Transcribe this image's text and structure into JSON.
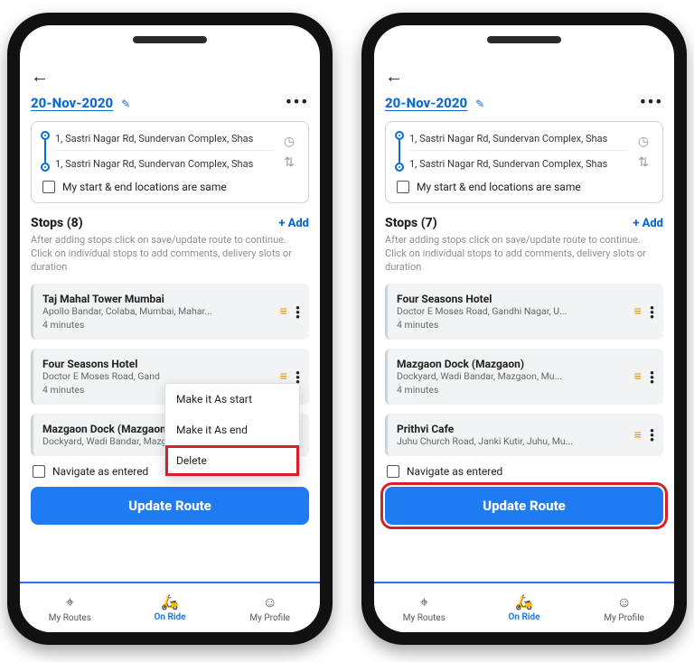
{
  "header": {
    "date": "20-Nov-2020",
    "more": "•••"
  },
  "routeCard": {
    "startAddress": "1, Sastri Nagar Rd, Sundervan Complex, Shas",
    "endAddress": "1, Sastri Nagar Rd, Sundervan Complex, Shas",
    "sameLocCheckbox": "My start & end locations are same"
  },
  "stopsSection": {
    "labelPrefix": "Stops",
    "addLabel": "+ Add",
    "hint": "After adding stops click on save/update route to continue. Click on individual stops to add comments, delivery slots or duration"
  },
  "navCheckbox": "Navigate as entered",
  "cta": "Update Route",
  "nav": {
    "routes": "My Routes",
    "onride": "On Ride",
    "profile": "My Profile"
  },
  "contextMenu": {
    "start": "Make it As start",
    "end": "Make it As end",
    "delete": "Delete"
  },
  "phones": [
    {
      "stopCountLabel": "Stops (8)",
      "menuTop": 396,
      "showMenu": true,
      "highlightCta": false,
      "stops": [
        {
          "name": "Taj Mahal Tower Mumbai",
          "addr": "Apollo Bandar, Colaba, Mumbai, Mahar...",
          "mins": "4 minutes",
          "showMins": true
        },
        {
          "name": "Four Seasons Hotel",
          "addr": "Doctor E Moses Road, Gand",
          "mins": "4 minutes",
          "showMins": true
        },
        {
          "name": "Mazgaon Dock (Mazgaon)",
          "addr": "Dockyard, Wadi Bandar, Mazgaon, Mu...",
          "mins": "",
          "showMins": false
        }
      ]
    },
    {
      "stopCountLabel": "Stops (7)",
      "showMenu": false,
      "highlightCta": true,
      "stops": [
        {
          "name": "Four Seasons Hotel",
          "addr": "Doctor E Moses Road, Gandhi Nagar, U...",
          "mins": "4 minutes",
          "showMins": true
        },
        {
          "name": "Mazgaon Dock (Mazgaon)",
          "addr": "Dockyard, Wadi Bandar, Mazgaon, Mu...",
          "mins": "4 minutes",
          "showMins": true
        },
        {
          "name": "Prithvi Cafe",
          "addr": "Juhu Church Road, Janki Kutir, Juhu, Mu...",
          "mins": "",
          "showMins": false
        }
      ]
    }
  ]
}
